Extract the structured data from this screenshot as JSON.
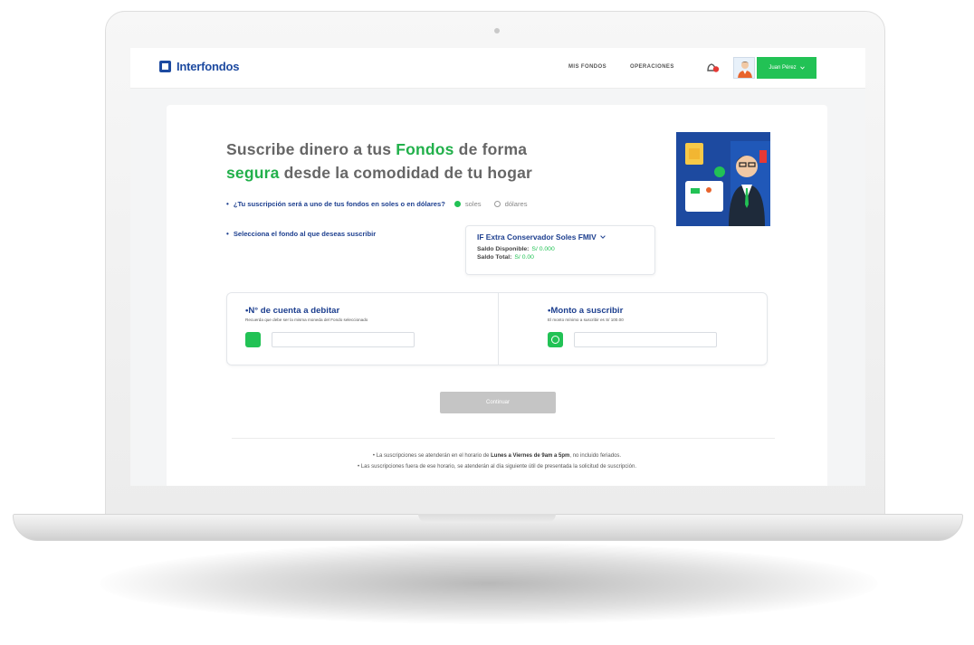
{
  "brand": {
    "name": "Interfondos",
    "accent": "#22c255",
    "primary": "#1d4aa0"
  },
  "nav": {
    "items": [
      "MIS FONDOS",
      "OPERACIONES"
    ]
  },
  "user": {
    "name": "Juan Pérez"
  },
  "hero": {
    "title_part1": "Suscribe dinero a tus ",
    "title_hl1": "Fondos",
    "title_part2": " de forma",
    "title_hl2": "segura",
    "title_part3": " desde la comodidad de tu hogar"
  },
  "currency": {
    "question": "¿Tu suscripción será a uno de tus fondos en soles o en dólares?",
    "options": [
      "soles",
      "dólares"
    ],
    "selected": "soles"
  },
  "fund": {
    "label": "Selecciona el fondo al que deseas suscribir",
    "name": "IF Extra Conservador Soles FMIV",
    "saldo_disponible_label": "Saldo Disponible:",
    "saldo_disponible_value": "S/ 0.000",
    "saldo_total_label": "Saldo Total:",
    "saldo_total_value": "S/ 0.00"
  },
  "account": {
    "title": "•N° de cuenta a debitar",
    "subtitle": "Recuerda que debe ser la misma moneda del Fondo seleccionado"
  },
  "amount": {
    "title": "•Monto a suscribir",
    "subtitle": "El monto mínimo a suscribir es S/ 100.00"
  },
  "cta": {
    "label": "Continuar"
  },
  "notes": {
    "line1_pre": "La suscripciones se atenderán en el horario de ",
    "line1_bold": "Lunes a Viernes de 9am a 5pm",
    "line1_post": ", no incluido feriados.",
    "line2": "Las suscripciones fuera de ese horario, se atenderán al día siguiente útil de presentada la solicitud de suscripción."
  },
  "icons": {
    "logo": "interfondos-logo-icon",
    "notification": "notification-bell-icon",
    "chevron": "chevron-down-icon",
    "account": "wallet-icon",
    "amount": "coin-icon"
  }
}
